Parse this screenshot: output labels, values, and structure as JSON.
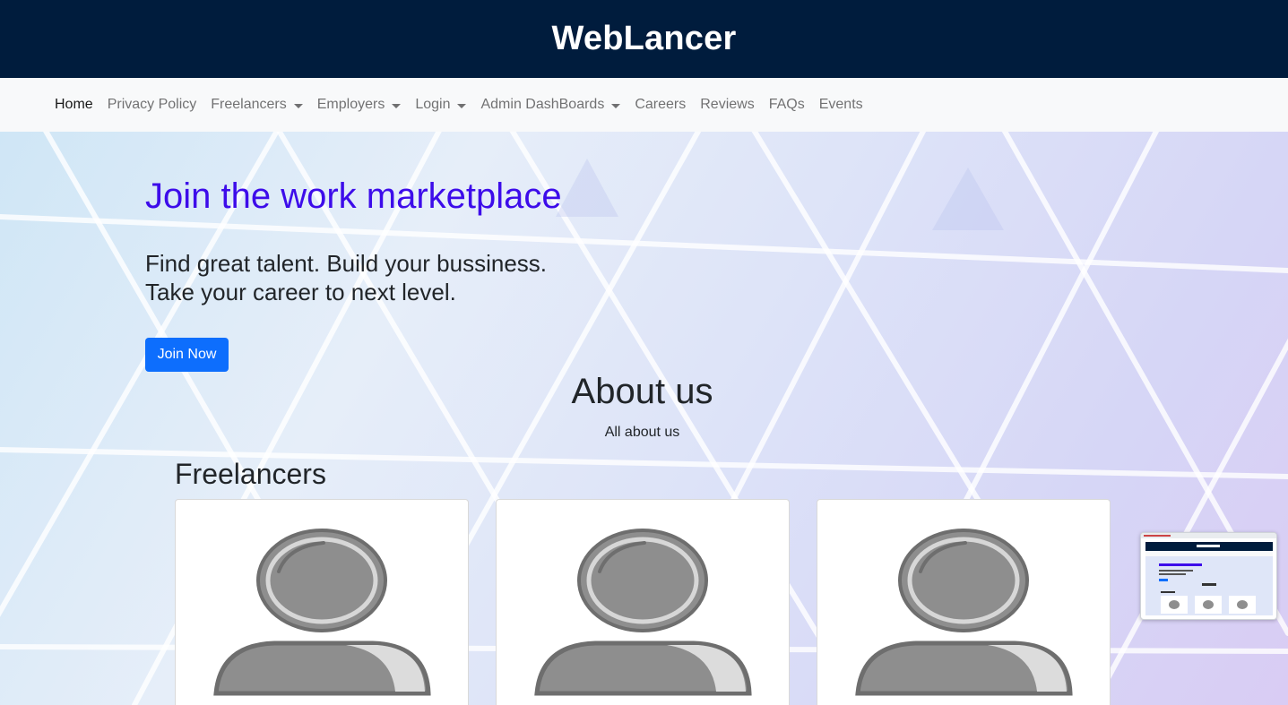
{
  "header": {
    "brand": "WebLancer"
  },
  "nav": {
    "items": [
      {
        "label": "Home",
        "active": true,
        "dropdown": false
      },
      {
        "label": "Privacy Policy",
        "dropdown": false
      },
      {
        "label": "Freelancers",
        "dropdown": true
      },
      {
        "label": "Employers",
        "dropdown": true
      },
      {
        "label": "Login",
        "dropdown": true
      },
      {
        "label": "Admin DashBoards",
        "dropdown": true
      },
      {
        "label": "Careers",
        "dropdown": false
      },
      {
        "label": "Reviews",
        "dropdown": false
      },
      {
        "label": "FAQs",
        "dropdown": false
      },
      {
        "label": "Events",
        "dropdown": false
      }
    ]
  },
  "hero": {
    "title": "Join the work marketplace",
    "lead_line1": "Find great talent. Build your bussiness.",
    "lead_line2": "Take your career to next level.",
    "button": "Join Now"
  },
  "about": {
    "title": "About us",
    "subtitle": "All about us"
  },
  "freelancers": {
    "title": "Freelancers",
    "cards": [
      {
        "icon": "user-avatar-icon"
      },
      {
        "icon": "user-avatar-icon"
      },
      {
        "icon": "user-avatar-icon"
      }
    ]
  },
  "colors": {
    "header_bg": "#001c3d",
    "hero_title": "#3d0cea",
    "primary_button": "#0d6efd",
    "navbar_bg": "#f8f9fa"
  },
  "thumbnail": {
    "icon": "screenshot-preview"
  }
}
